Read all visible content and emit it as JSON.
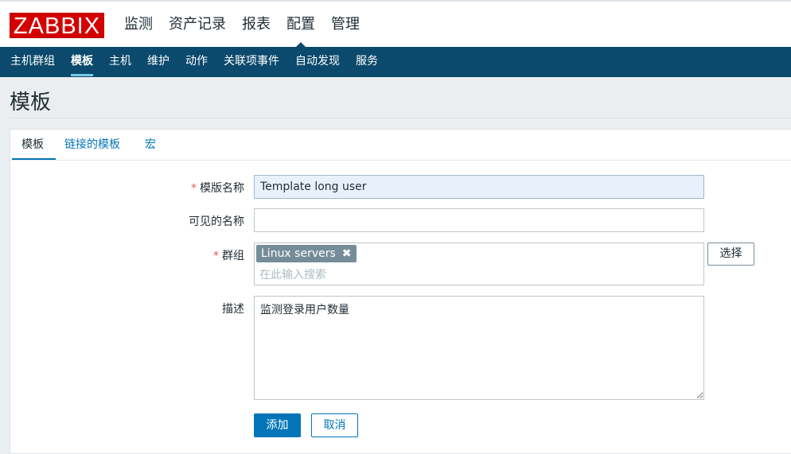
{
  "logo": {
    "text": "ZABBIX"
  },
  "main_menu": [
    {
      "label": "监测"
    },
    {
      "label": "资产记录"
    },
    {
      "label": "报表"
    },
    {
      "label": "配置",
      "active": true
    },
    {
      "label": "管理"
    }
  ],
  "sub_nav": [
    {
      "label": "主机群组"
    },
    {
      "label": "模板",
      "active": true
    },
    {
      "label": "主机"
    },
    {
      "label": "维护"
    },
    {
      "label": "动作"
    },
    {
      "label": "关联项事件"
    },
    {
      "label": "自动发现"
    },
    {
      "label": "服务"
    }
  ],
  "page": {
    "title": "模板"
  },
  "form": {
    "tabs": [
      {
        "label": "模板",
        "active": true
      },
      {
        "label": "链接的模板"
      },
      {
        "label": "宏"
      }
    ],
    "required_mark": "*",
    "template_name": {
      "label": "模版名称",
      "value": "Template long user"
    },
    "visible_name": {
      "label": "可见的名称",
      "value": ""
    },
    "groups": {
      "label": "群组",
      "selected": [
        "Linux servers"
      ],
      "remove_glyph": "✖",
      "placeholder": "在此输入搜索",
      "select_button": "选择"
    },
    "description": {
      "label": "描述",
      "value": "监测登录用户数量"
    },
    "add_button": "添加",
    "cancel_button": "取消"
  },
  "colors": {
    "accent": "#0275b8",
    "nav_bg": "#0b4a6c",
    "logo_red": "#d40000",
    "required": "#e45959"
  }
}
